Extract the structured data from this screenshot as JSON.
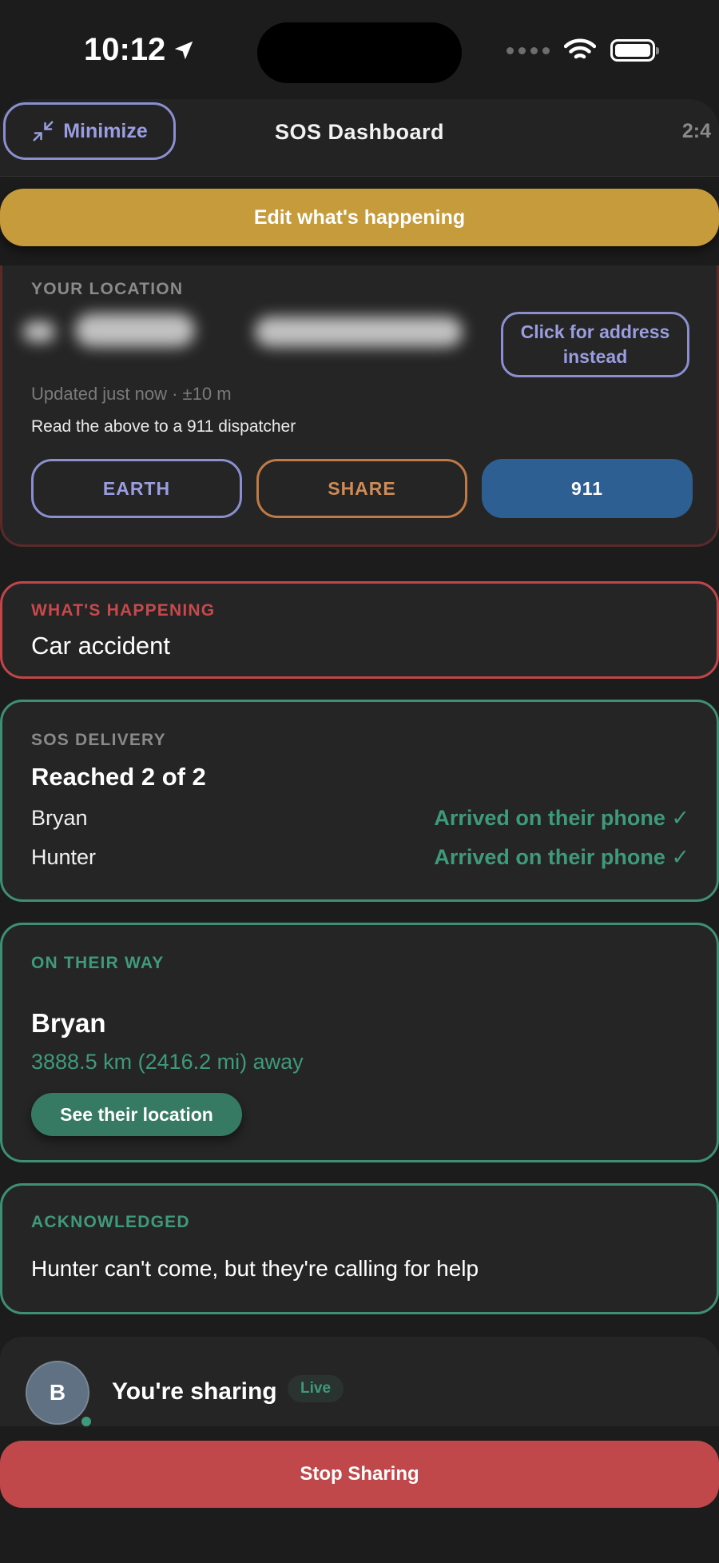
{
  "status_bar": {
    "time": "10:12"
  },
  "header": {
    "minimize_label": "Minimize",
    "title": "SOS Dashboard",
    "timer": "2:4"
  },
  "edit_button": "Edit what's happening",
  "location": {
    "label": "YOUR LOCATION",
    "address_button": "Click for address instead",
    "updated": "Updated just now · ±10 m",
    "read_instruction": "Read the above to a 911 dispatcher",
    "actions": {
      "earth": "EARTH",
      "share": "SHARE",
      "call": "911"
    }
  },
  "happening": {
    "label": "WHAT'S HAPPENING",
    "value": "Car accident"
  },
  "delivery": {
    "label": "SOS DELIVERY",
    "title": "Reached 2 of 2",
    "recipients": [
      {
        "name": "Bryan",
        "status": "Arrived on their phone ✓"
      },
      {
        "name": "Hunter",
        "status": "Arrived on their phone ✓"
      }
    ]
  },
  "on_their_way": {
    "label": "ON THEIR WAY",
    "name": "Bryan",
    "distance": "3888.5 km (2416.2 mi) away",
    "button": "See their location"
  },
  "acknowledged": {
    "label": "ACKNOWLEDGED",
    "text": "Hunter can't come, but they're calling for help"
  },
  "sharing": {
    "avatar_initial": "B",
    "text": "You're sharing",
    "badge": "Live"
  },
  "stop_button": "Stop Sharing",
  "colors": {
    "gold": "#c69b3c",
    "danger": "#c0484a",
    "green": "#3f9a7c",
    "indigo": "#8b8fd0",
    "orange": "#c07a45",
    "blue": "#2e5f92"
  },
  "icons": [
    "location-arrow-icon",
    "wifi-icon",
    "battery-icon",
    "minimize-arrows-icon",
    "cellular-dots-icon"
  ]
}
